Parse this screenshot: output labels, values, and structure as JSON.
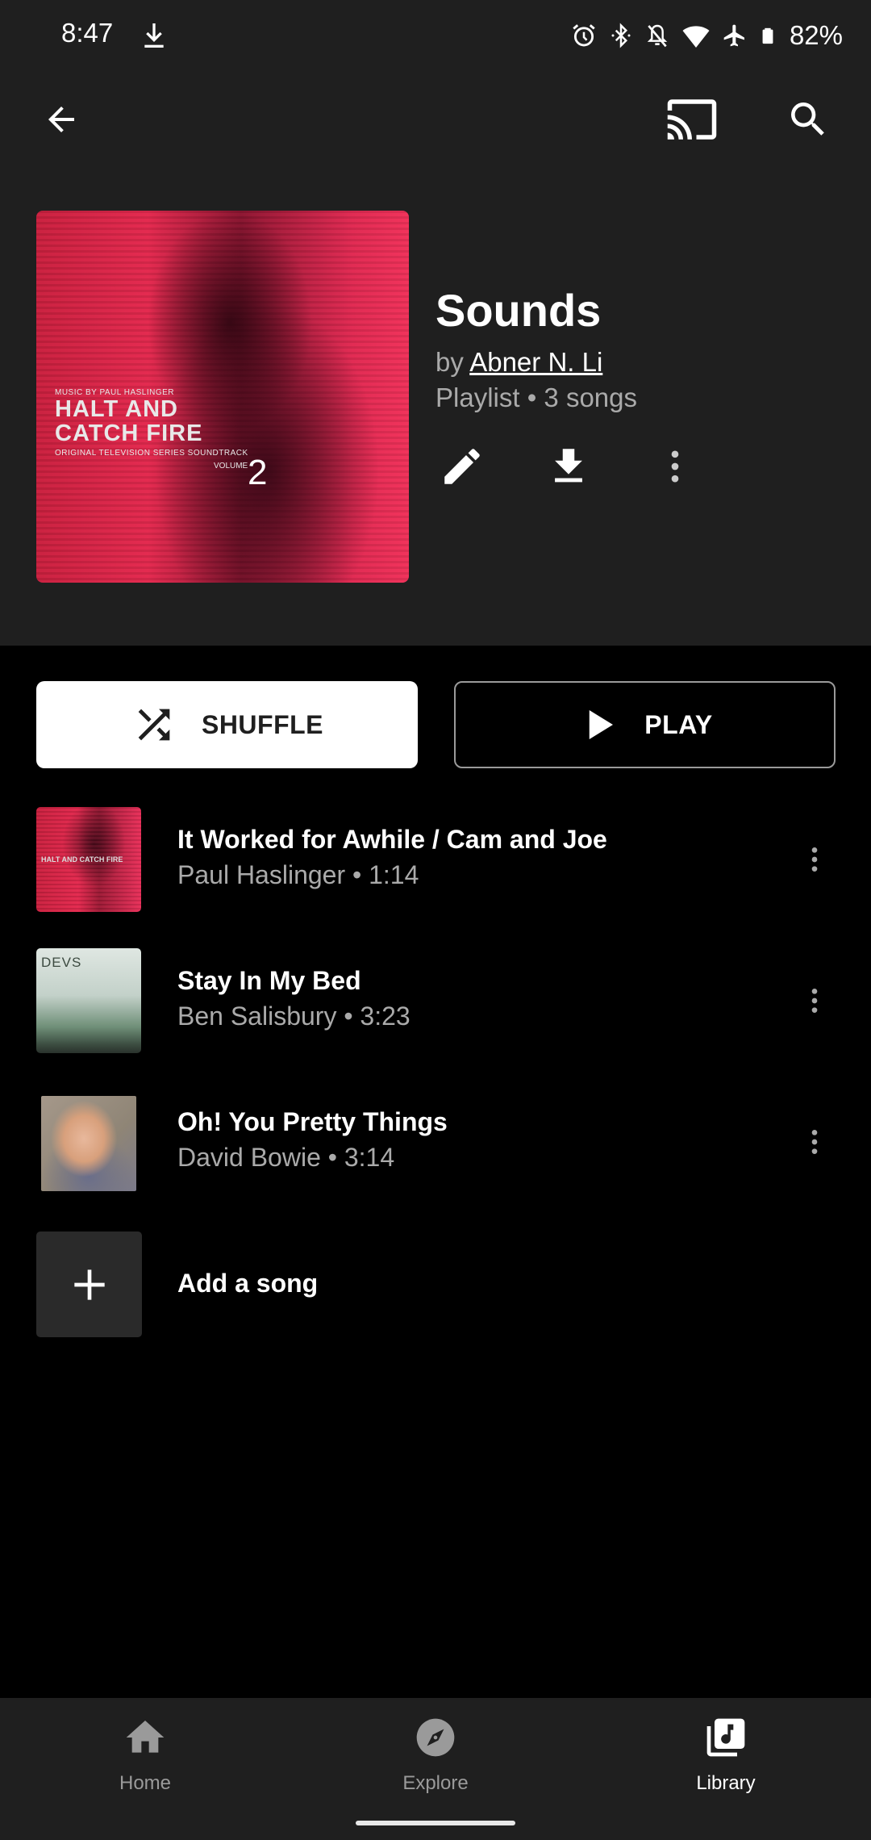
{
  "status_bar": {
    "time": "8:47",
    "battery": "82%",
    "icons": [
      "download-icon",
      "alarm-icon",
      "bluetooth-icon",
      "notifications-off-icon",
      "wifi-icon",
      "airplane-mode-icon",
      "battery-icon"
    ]
  },
  "app_bar": {
    "back_icon": "arrow-back-icon",
    "cast_icon": "cast-icon",
    "search_icon": "search-icon"
  },
  "album_art": {
    "credit": "MUSIC BY PAUL HASLINGER",
    "title_line1": "HALT AND",
    "title_line2": "CATCH FIRE",
    "subtitle": "ORIGINAL TELEVISION SERIES SOUNDTRACK",
    "volume_label": "VOLUME",
    "volume_number": "2"
  },
  "playlist": {
    "title": "Sounds",
    "by_prefix": "by",
    "author": "Abner N. Li",
    "meta": "Playlist • 3 songs",
    "actions": [
      "edit-icon",
      "download-icon",
      "more-vert-icon"
    ]
  },
  "controls": {
    "shuffle_label": "SHUFFLE",
    "play_label": "PLAY"
  },
  "songs": [
    {
      "title": "It Worked for Awhile / Cam and Joe",
      "artist": "Paul Haslinger",
      "duration": "1:14",
      "subtitle": "Paul Haslinger • 1:14",
      "thumb_text": "HALT AND CATCH FIRE"
    },
    {
      "title": "Stay In My Bed",
      "artist": "Ben Salisbury",
      "duration": "3:23",
      "subtitle": "Ben Salisbury • 3:23",
      "thumb_text": "DEVS"
    },
    {
      "title": "Oh! You Pretty Things",
      "artist": "David Bowie",
      "duration": "3:14",
      "subtitle": "David Bowie • 3:14",
      "thumb_text": ""
    }
  ],
  "add_song": {
    "label": "Add a song"
  },
  "bottom_nav": {
    "items": [
      {
        "label": "Home",
        "icon": "home-icon",
        "active": false
      },
      {
        "label": "Explore",
        "icon": "explore-icon",
        "active": false
      },
      {
        "label": "Library",
        "icon": "library-music-icon",
        "active": true
      }
    ]
  },
  "colors": {
    "header_bg": "#1f1f1f",
    "body_bg": "#000000",
    "secondary_text": "#aaaaaa",
    "inactive_nav": "#9a9a9a"
  }
}
